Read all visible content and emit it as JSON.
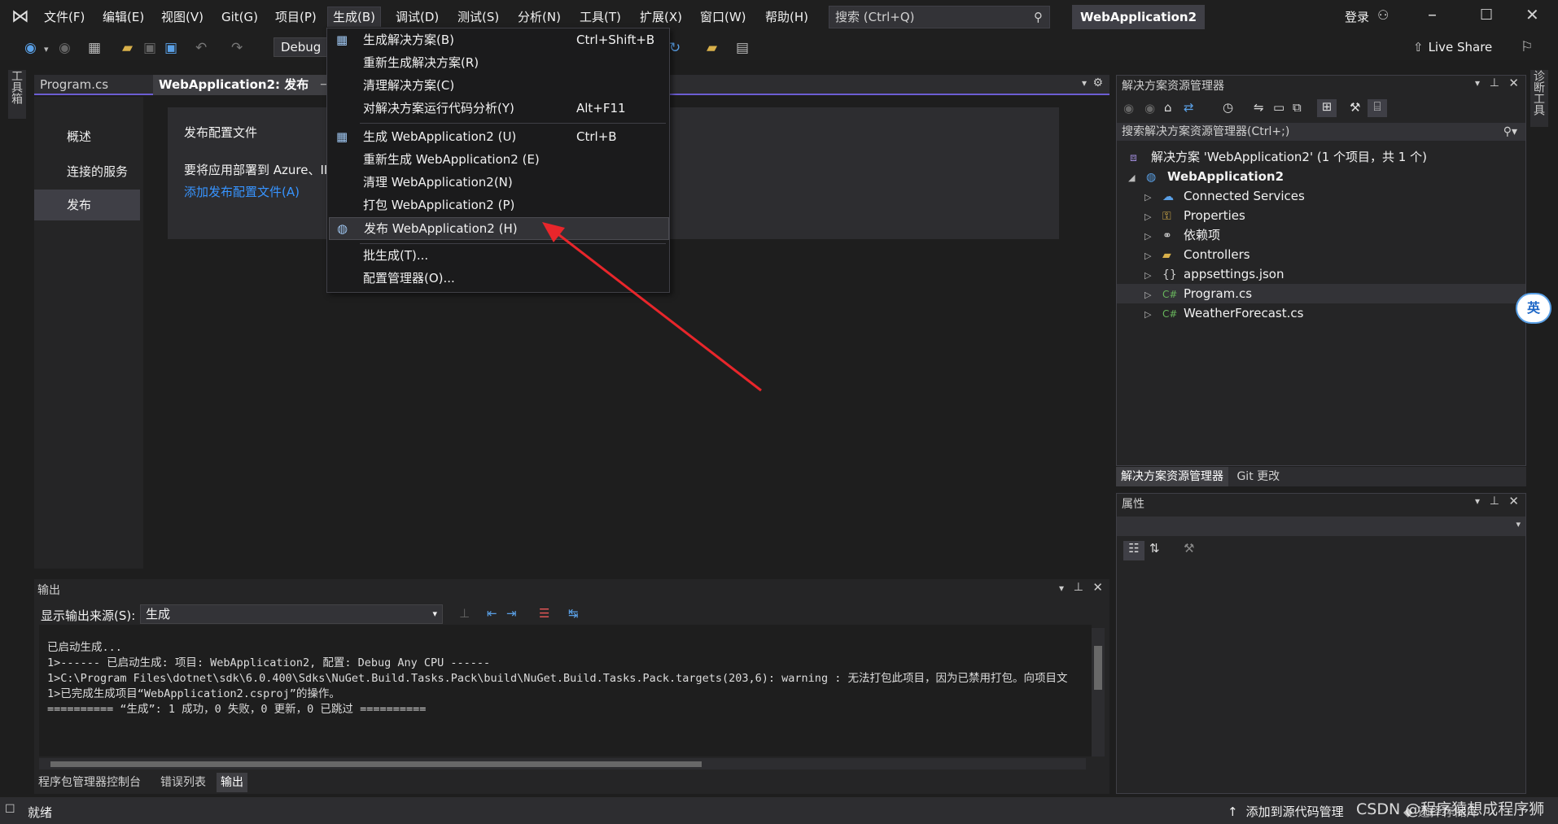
{
  "menubar": {
    "items": [
      "文件(F)",
      "编辑(E)",
      "视图(V)",
      "Git(G)",
      "项目(P)",
      "生成(B)",
      "调试(D)",
      "测试(S)",
      "分析(N)",
      "工具(T)",
      "扩展(X)",
      "窗口(W)",
      "帮助(H)"
    ],
    "search_placeholder": "搜索 (Ctrl+Q)",
    "solution_name": "WebApplication2",
    "login": "登录"
  },
  "toolbar": {
    "config": "Debug",
    "live_share": "Live Share"
  },
  "side": {
    "left": "工具箱",
    "right": "诊断工具"
  },
  "doc_tabs": [
    "Program.cs",
    "WebApplication2: 发布"
  ],
  "publish": {
    "nav": [
      "概述",
      "连接的服务",
      "发布"
    ],
    "card_title": "发布配置文件",
    "card_text": "要将应用部署到 Azure、II",
    "card_link": "添加发布配置文件(A)"
  },
  "build_menu": {
    "items": [
      {
        "label": "生成解决方案(B)",
        "shortcut": "Ctrl+Shift+B",
        "icon": "build-icon"
      },
      {
        "label": "重新生成解决方案(R)",
        "shortcut": "",
        "icon": ""
      },
      {
        "label": "清理解决方案(C)",
        "shortcut": "",
        "icon": ""
      },
      {
        "label": "对解决方案运行代码分析(Y)",
        "shortcut": "Alt+F11",
        "icon": ""
      },
      {
        "label": "生成 WebApplication2 (U)",
        "shortcut": "Ctrl+B",
        "icon": "build-icon"
      },
      {
        "label": "重新生成 WebApplication2 (E)",
        "shortcut": "",
        "icon": ""
      },
      {
        "label": "清理 WebApplication2(N)",
        "shortcut": "",
        "icon": ""
      },
      {
        "label": "打包 WebApplication2 (P)",
        "shortcut": "",
        "icon": ""
      },
      {
        "label": "发布 WebApplication2 (H)",
        "shortcut": "",
        "icon": "globe-icon"
      },
      {
        "label": "批生成(T)...",
        "shortcut": "",
        "icon": ""
      },
      {
        "label": "配置管理器(O)...",
        "shortcut": "",
        "icon": ""
      }
    ]
  },
  "solution_explorer": {
    "title": "解决方案资源管理器",
    "search_placeholder": "搜索解决方案资源管理器(Ctrl+;)",
    "solution_line": "解决方案 'WebApplication2' (1 个项目，共 1 个)",
    "project": "WebApplication2",
    "items": [
      "Connected Services",
      "Properties",
      "依赖项",
      "Controllers",
      "appsettings.json",
      "Program.cs",
      "WeatherForecast.cs"
    ],
    "bottom_tabs": [
      "解决方案资源管理器",
      "Git 更改"
    ]
  },
  "properties": {
    "title": "属性"
  },
  "output": {
    "title": "输出",
    "source_label": "显示输出来源(S):",
    "source_value": "生成",
    "lines": [
      "已启动生成...",
      "1>------ 已启动生成: 项目: WebApplication2, 配置: Debug Any CPU ------",
      "1>C:\\Program Files\\dotnet\\sdk\\6.0.400\\Sdks\\NuGet.Build.Tasks.Pack\\build\\NuGet.Build.Tasks.Pack.targets(203,6): warning : 无法打包此项目，因为已禁用打包。向项目文",
      "1>已完成生成项目“WebApplication2.csproj”的操作。",
      "========== “生成”: 1 成功，0 失败，0 更新，0 已跳过 =========="
    ],
    "bottom_tabs": [
      "程序包管理器控制台",
      "错误列表",
      "输出"
    ]
  },
  "statusbar": {
    "status": "就绪",
    "add_source_control": "添加到源代码管理",
    "select_repo": "选择存储库",
    "watermark": "CSDN @程序猿想成程序狮"
  },
  "ime_badge": "英",
  "colors": {
    "accent": "#6c5dd3",
    "arrow": "#e8262b",
    "link": "#3794ff"
  }
}
